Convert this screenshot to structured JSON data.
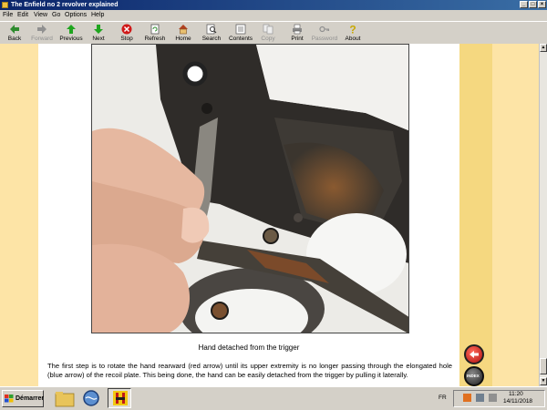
{
  "window": {
    "title": "The Enfield no 2 revolver explained"
  },
  "menu": [
    "File",
    "Edit",
    "View",
    "Go",
    "Options",
    "Help"
  ],
  "toolbar": {
    "back": "Back",
    "forward": "Forward",
    "previous": "Previous",
    "next": "Next",
    "stop": "Stop",
    "refresh": "Refresh",
    "home": "Home",
    "search": "Search",
    "contents": "Contents",
    "copy": "Copy",
    "print": "Print",
    "password": "Password",
    "about": "About"
  },
  "content": {
    "caption": "Hand detached from the trigger",
    "paragraph": "The first step is to rotate the hand rearward (red arrow) until its upper extremity is no longer passing through the elongated hole (blue arrow) of the recoil plate. This being done, the hand can be easily detached from the trigger by pulling it laterally."
  },
  "navigation": {
    "back_icon": "red-back-arrow-icon",
    "index_label": "INDEX"
  },
  "taskbar": {
    "start": "Démarrer",
    "language": "FR",
    "time": "11:20",
    "date": "14/11/2018"
  },
  "colors": {
    "titlebar": "#0a246a",
    "page_background": "#fde4a6",
    "stripe": "#f5d880"
  }
}
